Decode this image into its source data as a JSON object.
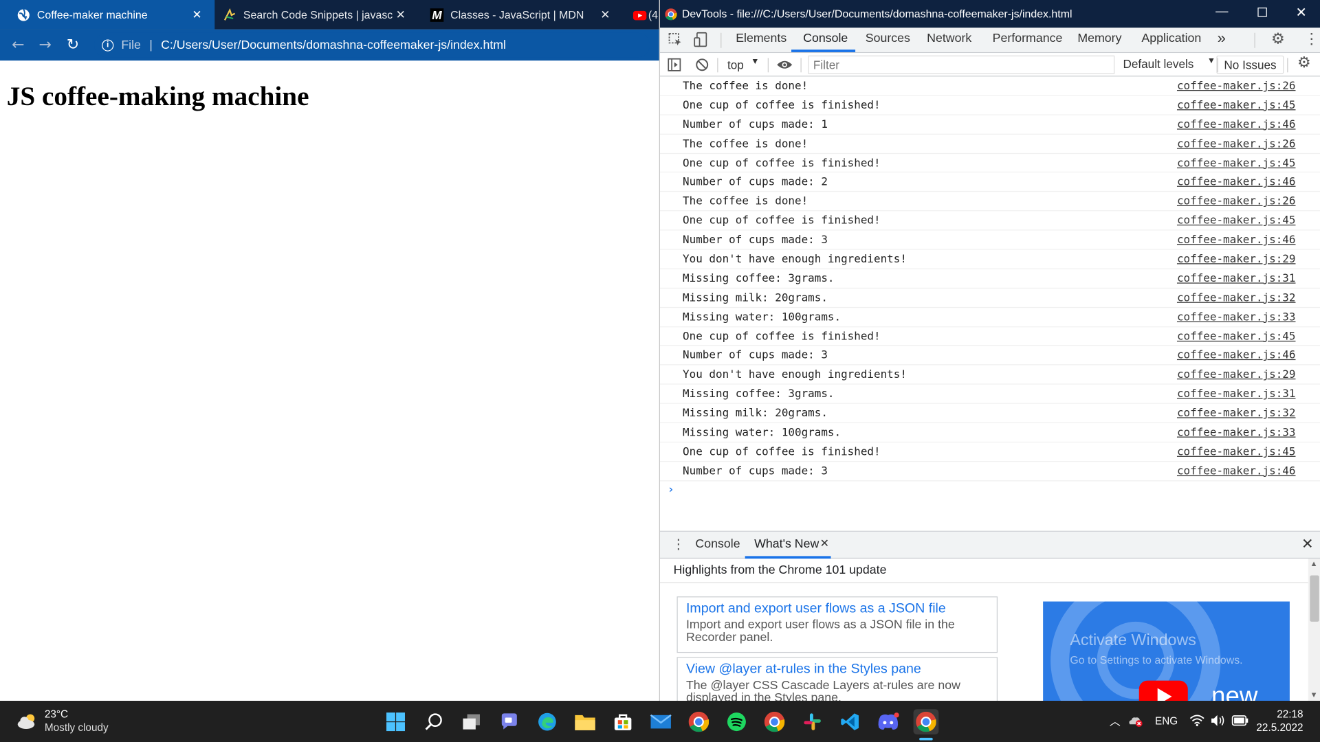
{
  "browser": {
    "tabs": [
      {
        "title": "Coffee-maker machine",
        "close": "✕"
      },
      {
        "title": "Search Code Snippets | javascript",
        "close": "✕"
      },
      {
        "title": "Classes - JavaScript | MDN",
        "close": "✕"
      },
      {
        "title": "(4",
        "close": ""
      }
    ],
    "address": {
      "scheme_label": "File",
      "url": "C:/Users/User/Documents/domashna-coffeemaker-js/index.html"
    },
    "page_heading": "JS coffee-making machine"
  },
  "devtools": {
    "title": "DevTools - file:///C:/Users/User/Documents/domashna-coffeemaker-js/index.html",
    "panels": [
      "Elements",
      "Console",
      "Sources",
      "Network",
      "Performance",
      "Memory",
      "Application"
    ],
    "active_panel": "Console",
    "more_tabs": "»",
    "toolbar": {
      "context": "top",
      "filter_placeholder": "Filter",
      "levels": "Default levels",
      "issues": "No Issues"
    },
    "console": [
      {
        "msg": "The coffee is done!",
        "src": "coffee-maker.js:26"
      },
      {
        "msg": "One cup of coffee is finished!",
        "src": "coffee-maker.js:45"
      },
      {
        "msg": "Number of cups made: 1",
        "src": "coffee-maker.js:46"
      },
      {
        "msg": "The coffee is done!",
        "src": "coffee-maker.js:26"
      },
      {
        "msg": "One cup of coffee is finished!",
        "src": "coffee-maker.js:45"
      },
      {
        "msg": "Number of cups made: 2",
        "src": "coffee-maker.js:46"
      },
      {
        "msg": "The coffee is done!",
        "src": "coffee-maker.js:26"
      },
      {
        "msg": "One cup of coffee is finished!",
        "src": "coffee-maker.js:45"
      },
      {
        "msg": "Number of cups made: 3",
        "src": "coffee-maker.js:46"
      },
      {
        "msg": "You don't have enough ingredients!",
        "src": "coffee-maker.js:29"
      },
      {
        "msg": "Missing coffee: 3grams.",
        "src": "coffee-maker.js:31"
      },
      {
        "msg": "Missing milk: 20grams.",
        "src": "coffee-maker.js:32"
      },
      {
        "msg": "Missing water: 100grams.",
        "src": "coffee-maker.js:33"
      },
      {
        "msg": "One cup of coffee is finished!",
        "src": "coffee-maker.js:45"
      },
      {
        "msg": "Number of cups made: 3",
        "src": "coffee-maker.js:46"
      },
      {
        "msg": "You don't have enough ingredients!",
        "src": "coffee-maker.js:29"
      },
      {
        "msg": "Missing coffee: 3grams.",
        "src": "coffee-maker.js:31"
      },
      {
        "msg": "Missing milk: 20grams.",
        "src": "coffee-maker.js:32"
      },
      {
        "msg": "Missing water: 100grams.",
        "src": "coffee-maker.js:33"
      },
      {
        "msg": "One cup of coffee is finished!",
        "src": "coffee-maker.js:45"
      },
      {
        "msg": "Number of cups made: 3",
        "src": "coffee-maker.js:46"
      }
    ],
    "prompt": "›",
    "drawer": {
      "tabs": [
        "Console",
        "What's New"
      ],
      "active_tab": "What's New",
      "heading": "Highlights from the Chrome 101 update",
      "cards": [
        {
          "title": "Import and export user flows as a JSON file",
          "desc": "Import and export user flows as a JSON file in the Recorder panel."
        },
        {
          "title": "View @layer at-rules in the Styles pane",
          "desc": "The @layer CSS Cascade Layers at-rules are now displayed in the Styles pane."
        }
      ],
      "promo": {
        "watermark_1": "Activate Windows",
        "watermark_2": "Go to Settings to activate Windows.",
        "badge": "new"
      }
    }
  },
  "taskbar": {
    "weather": {
      "temp": "23°C",
      "desc": "Mostly cloudy"
    },
    "language": "ENG",
    "time": "22:18",
    "date": "22.5.2022"
  },
  "colors": {
    "title_bar": "#0e2240",
    "active_tab": "#0b57a4",
    "link_blue": "#1a73e8",
    "taskbar": "#202020"
  }
}
